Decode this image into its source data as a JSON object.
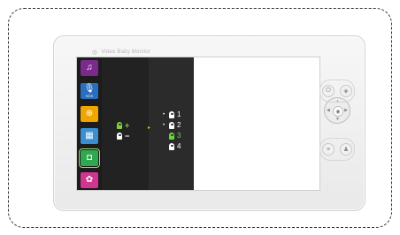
{
  "device": {
    "brand_text": "Video Baby Monitor"
  },
  "sidebar": {
    "items": [
      {
        "name": "music",
        "icon": "music-note-icon",
        "color": "#7b2a8c",
        "glyph": "♫",
        "sub": ""
      },
      {
        "name": "vox",
        "icon": "microphone-icon",
        "color": "#2a6fbf",
        "glyph": "🎙",
        "sub": "VOX"
      },
      {
        "name": "zoom",
        "icon": "zoom-icon",
        "color": "#f0a500",
        "glyph": "⊕",
        "sub": ""
      },
      {
        "name": "split",
        "icon": "split-view-icon",
        "color": "#3b8fd1",
        "glyph": "▦",
        "sub": ""
      },
      {
        "name": "camera",
        "icon": "camera-icon",
        "color": "#2fa84f",
        "glyph": "◘",
        "sub": "",
        "selected": true
      },
      {
        "name": "settings",
        "icon": "gear-icon",
        "color": "#d0368f",
        "glyph": "✿",
        "sub": ""
      }
    ]
  },
  "camera_menu": {
    "add": {
      "sign": "+",
      "color": "#7fd23a"
    },
    "remove": {
      "sign": "−",
      "color": "#ffffff"
    },
    "cameras": [
      {
        "label": "1",
        "paired": true,
        "color": "#ffffff"
      },
      {
        "label": "2",
        "paired": true,
        "color": "#ffffff"
      },
      {
        "label": "3",
        "paired": false,
        "color": "#6cd43b"
      },
      {
        "label": "4",
        "paired": false,
        "color": "#ffffff"
      }
    ]
  },
  "buttons": {
    "power_glyph": "⏻",
    "menu_glyph": "≡",
    "talk_glyph": "♟",
    "nav_glyph": "◈"
  }
}
